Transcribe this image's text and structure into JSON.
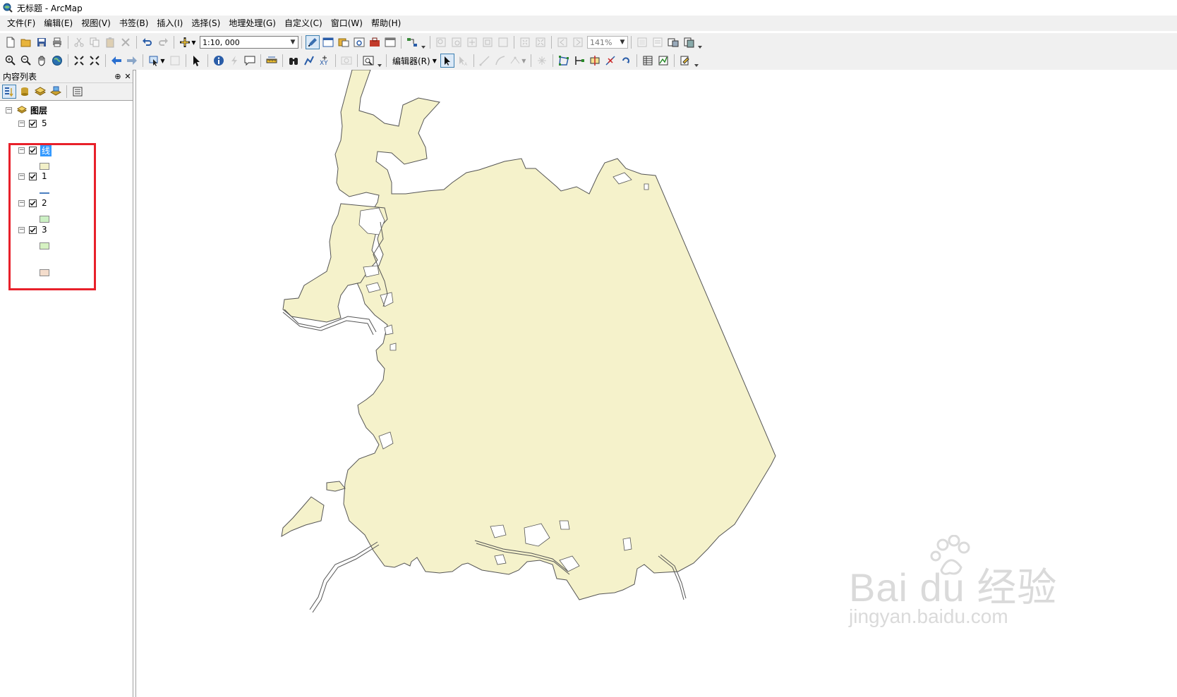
{
  "window": {
    "title": "无标题 - ArcMap",
    "app_icon": "arcmap-globe-icon"
  },
  "menu": [
    "文件(F)",
    "编辑(E)",
    "视图(V)",
    "书签(B)",
    "插入(I)",
    "选择(S)",
    "地理处理(G)",
    "自定义(C)",
    "窗口(W)",
    "帮助(H)"
  ],
  "toolbar": {
    "scale": "1:10, 000",
    "zoom_level": "141%",
    "editor_label": "编辑器(R)"
  },
  "toc": {
    "title": "内容列表",
    "pin_glyph": "⊕",
    "close_glyph": "✕",
    "group": "图层",
    "layers": [
      {
        "name": "5",
        "checked": true,
        "swatch": "#f2f0c8",
        "kind": "polygon"
      },
      {
        "name": "线",
        "checked": true,
        "swatch": "#4a7fc0",
        "kind": "line",
        "selected": true
      },
      {
        "name": "1",
        "checked": true,
        "swatch": "#ccf0c4",
        "kind": "polygon"
      },
      {
        "name": "2",
        "checked": true,
        "swatch": "#d6f2c2",
        "kind": "polygon"
      },
      {
        "name": "3",
        "checked": true,
        "swatch": "#f4ddcc",
        "kind": "polygon"
      }
    ],
    "highlight_color": "#e8202a"
  },
  "map": {
    "fill": "#f5f2cb",
    "outline": "#555555"
  },
  "watermark": {
    "brand": "Bai du 经验",
    "url": "jingyan.baidu.com"
  }
}
